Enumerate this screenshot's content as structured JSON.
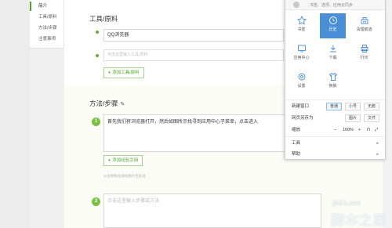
{
  "sidebar": {
    "items": [
      {
        "label": "简介",
        "active": true
      },
      {
        "label": "工具/原料",
        "active": false
      },
      {
        "label": "方法/步骤",
        "active": false
      },
      {
        "label": "注意事项",
        "active": false
      }
    ]
  },
  "tools_section": {
    "title": "工具/原料",
    "tool1_value": "QQ浏览器",
    "tool2_placeholder": "点击这里输入工具/原料",
    "add_button": "添加工具/原料"
  },
  "steps_section": {
    "title": "方法/步骤",
    "step1": {
      "number": "1",
      "text": "首先我们将浏览器打开，然后如图所示找寻到应用中心子菜单，点击进入"
    },
    "add_ref_button": "添加经验引用",
    "note": "从右侧拖动添加图片至此处",
    "step2": {
      "number": "2",
      "placeholder": "点击这里输入步骤或方法"
    }
  },
  "menu": {
    "sync_text": "书签、选项、应用云同步",
    "grid": [
      {
        "label": "书签",
        "icon": "star-icon",
        "active": false
      },
      {
        "label": "历史",
        "icon": "clock-icon",
        "active": true
      },
      {
        "label": "清理痕迹",
        "icon": "clean-icon",
        "active": false
      },
      {
        "label": "应用中心",
        "icon": "app-center-icon",
        "active": false
      },
      {
        "label": "下载",
        "icon": "download-icon",
        "active": false
      },
      {
        "label": "打印",
        "icon": "printer-icon",
        "active": false
      },
      {
        "label": "设置",
        "icon": "gear-icon",
        "active": false
      },
      {
        "label": "换肤",
        "icon": "shirt-icon",
        "active": false
      }
    ],
    "new_window": {
      "label": "新建窗口",
      "options": [
        "普通",
        "小号",
        "无痕"
      ]
    },
    "save_as": {
      "label": "网页另存为",
      "options": [
        "图片",
        "文件"
      ]
    },
    "zoom": {
      "label": "缩放",
      "value": "100%"
    },
    "tools": {
      "label": "工具"
    },
    "help": {
      "label": "帮助"
    }
  },
  "watermark": {
    "url": "jb51.net",
    "brand": "脚本之家"
  },
  "colors": {
    "accent_green": "#5bb631",
    "menu_highlight": "#4a8ed8"
  }
}
